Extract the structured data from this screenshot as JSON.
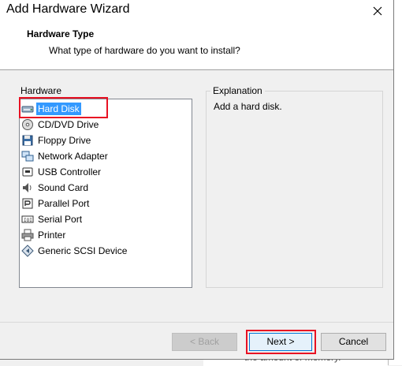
{
  "window": {
    "title": "Add Hardware Wizard"
  },
  "header": {
    "title": "Hardware Type",
    "subtitle": "What type of hardware do you want to install?"
  },
  "hardware": {
    "label": "Hardware",
    "items": [
      {
        "label": "Hard Disk",
        "icon": "hard-disk-icon",
        "selected": true
      },
      {
        "label": "CD/DVD Drive",
        "icon": "cd-dvd-icon"
      },
      {
        "label": "Floppy Drive",
        "icon": "floppy-icon"
      },
      {
        "label": "Network Adapter",
        "icon": "network-adapter-icon"
      },
      {
        "label": "USB Controller",
        "icon": "usb-icon"
      },
      {
        "label": "Sound Card",
        "icon": "sound-card-icon"
      },
      {
        "label": "Parallel Port",
        "icon": "parallel-port-icon"
      },
      {
        "label": "Serial Port",
        "icon": "serial-port-icon"
      },
      {
        "label": "Printer",
        "icon": "printer-icon"
      },
      {
        "label": "Generic SCSI Device",
        "icon": "scsi-icon"
      }
    ]
  },
  "explanation": {
    "label": "Explanation",
    "text": "Add a hard disk."
  },
  "buttons": {
    "back": "< Back",
    "next": "Next >",
    "cancel": "Cancel"
  },
  "background": {
    "bottom_text": "the amount of memory."
  },
  "colors": {
    "selection": "#3399ff",
    "highlight_box": "#e81123",
    "default_button_border": "#0078d7"
  }
}
